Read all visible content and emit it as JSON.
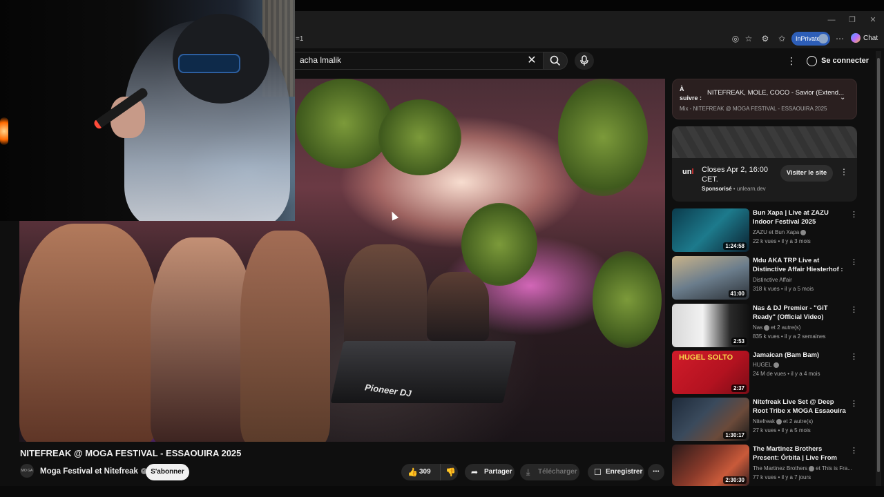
{
  "browser": {
    "url": "=1",
    "inprivate_label": "InPrivate",
    "chat_label": "Chat"
  },
  "header": {
    "search_query": "acha lmalik",
    "signin_label": "Se connecter"
  },
  "video": {
    "title": "NITEFREAK @ MOGA FESTIVAL - ESSAOUIRA 2025",
    "channel": "Moga Festival et Nitefreak",
    "channel_avatar_text": "MO GA",
    "subscribe_label": "S'abonner",
    "like_count": "309",
    "share_label": "Partager",
    "download_label": "Télécharger",
    "save_label": "Enregistrer",
    "deck_brand": "Pioneer DJ"
  },
  "up_next": {
    "label": "À suivre :",
    "title": "NITEFREAK, MOLE, COCO - Savior (Extend...",
    "subtitle": "Mix - NITEFREAK @ MOGA FESTIVAL - ESSAOUIRA 2025"
  },
  "ad": {
    "logo": "un",
    "logo_accent": "l",
    "title": "Closes Apr 2, 16:00 CET.",
    "sponsored": "Sponsorisé",
    "domain": "unlearn.dev",
    "cta": "Visiter le site"
  },
  "recommendations": [
    {
      "title": "Bun Xapa | Live at ZAZU Indoor Festival 2025",
      "channel": "ZAZU et Bun Xapa",
      "meta": "22 k vues • il y a 3 mois",
      "duration": "1:24:58",
      "verified": true
    },
    {
      "title": "Mdu AKA TRP Live at Distinctive Affair Hiesterhof : ...",
      "channel": "Distinctive Affair",
      "meta": "318 k vues • il y a 5 mois",
      "duration": "41:00",
      "verified": false
    },
    {
      "title": "Nas & DJ Premier - \"GiT Ready\" (Official Video)",
      "channel": "Nas",
      "channel_extra": "et 2 autre(s)",
      "meta": "835 k vues • il y a 2 semaines",
      "duration": "2:53",
      "verified": true
    },
    {
      "title": "Jamaican (Bam Bam)",
      "channel": "HUGEL",
      "meta": "24 M de vues • il y a 4 mois",
      "duration": "2:37",
      "verified": true,
      "thumb_text": "HUGEL SOLTO"
    },
    {
      "title": "Nitefreak Live Set @ Deep Root Tribe x MOGA Essaouira",
      "channel": "Nitefreak",
      "channel_extra": "et 2 autre(s)",
      "meta": "27 k vues • il y a 5 mois",
      "duration": "1:30:17",
      "verified": true
    },
    {
      "title": "The Martinez Brothers Present: Órbita | Live From ReFrame ...",
      "channel": "The Martinez Brothers",
      "channel_extra": "et This is Fra...",
      "meta": "77 k vues • il y a 7 jours",
      "duration": "2:30:30",
      "verified": true
    }
  ]
}
